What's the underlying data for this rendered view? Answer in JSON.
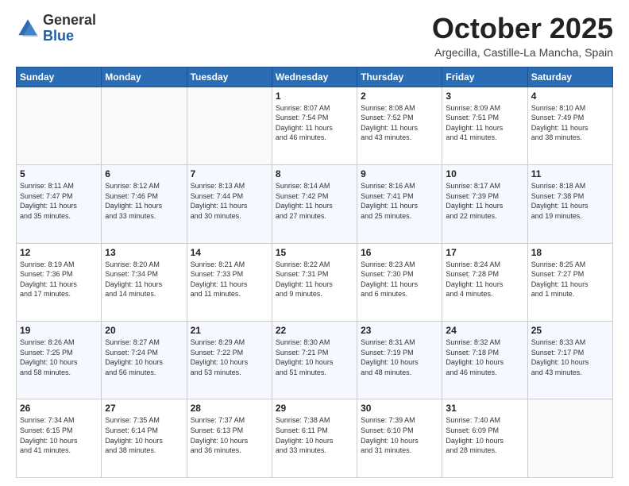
{
  "logo": {
    "general": "General",
    "blue": "Blue"
  },
  "header": {
    "month": "October 2025",
    "location": "Argecilla, Castille-La Mancha, Spain"
  },
  "days_of_week": [
    "Sunday",
    "Monday",
    "Tuesday",
    "Wednesday",
    "Thursday",
    "Friday",
    "Saturday"
  ],
  "weeks": [
    [
      {
        "day": "",
        "info": ""
      },
      {
        "day": "",
        "info": ""
      },
      {
        "day": "",
        "info": ""
      },
      {
        "day": "1",
        "info": "Sunrise: 8:07 AM\nSunset: 7:54 PM\nDaylight: 11 hours\nand 46 minutes."
      },
      {
        "day": "2",
        "info": "Sunrise: 8:08 AM\nSunset: 7:52 PM\nDaylight: 11 hours\nand 43 minutes."
      },
      {
        "day": "3",
        "info": "Sunrise: 8:09 AM\nSunset: 7:51 PM\nDaylight: 11 hours\nand 41 minutes."
      },
      {
        "day": "4",
        "info": "Sunrise: 8:10 AM\nSunset: 7:49 PM\nDaylight: 11 hours\nand 38 minutes."
      }
    ],
    [
      {
        "day": "5",
        "info": "Sunrise: 8:11 AM\nSunset: 7:47 PM\nDaylight: 11 hours\nand 35 minutes."
      },
      {
        "day": "6",
        "info": "Sunrise: 8:12 AM\nSunset: 7:46 PM\nDaylight: 11 hours\nand 33 minutes."
      },
      {
        "day": "7",
        "info": "Sunrise: 8:13 AM\nSunset: 7:44 PM\nDaylight: 11 hours\nand 30 minutes."
      },
      {
        "day": "8",
        "info": "Sunrise: 8:14 AM\nSunset: 7:42 PM\nDaylight: 11 hours\nand 27 minutes."
      },
      {
        "day": "9",
        "info": "Sunrise: 8:16 AM\nSunset: 7:41 PM\nDaylight: 11 hours\nand 25 minutes."
      },
      {
        "day": "10",
        "info": "Sunrise: 8:17 AM\nSunset: 7:39 PM\nDaylight: 11 hours\nand 22 minutes."
      },
      {
        "day": "11",
        "info": "Sunrise: 8:18 AM\nSunset: 7:38 PM\nDaylight: 11 hours\nand 19 minutes."
      }
    ],
    [
      {
        "day": "12",
        "info": "Sunrise: 8:19 AM\nSunset: 7:36 PM\nDaylight: 11 hours\nand 17 minutes."
      },
      {
        "day": "13",
        "info": "Sunrise: 8:20 AM\nSunset: 7:34 PM\nDaylight: 11 hours\nand 14 minutes."
      },
      {
        "day": "14",
        "info": "Sunrise: 8:21 AM\nSunset: 7:33 PM\nDaylight: 11 hours\nand 11 minutes."
      },
      {
        "day": "15",
        "info": "Sunrise: 8:22 AM\nSunset: 7:31 PM\nDaylight: 11 hours\nand 9 minutes."
      },
      {
        "day": "16",
        "info": "Sunrise: 8:23 AM\nSunset: 7:30 PM\nDaylight: 11 hours\nand 6 minutes."
      },
      {
        "day": "17",
        "info": "Sunrise: 8:24 AM\nSunset: 7:28 PM\nDaylight: 11 hours\nand 4 minutes."
      },
      {
        "day": "18",
        "info": "Sunrise: 8:25 AM\nSunset: 7:27 PM\nDaylight: 11 hours\nand 1 minute."
      }
    ],
    [
      {
        "day": "19",
        "info": "Sunrise: 8:26 AM\nSunset: 7:25 PM\nDaylight: 10 hours\nand 58 minutes."
      },
      {
        "day": "20",
        "info": "Sunrise: 8:27 AM\nSunset: 7:24 PM\nDaylight: 10 hours\nand 56 minutes."
      },
      {
        "day": "21",
        "info": "Sunrise: 8:29 AM\nSunset: 7:22 PM\nDaylight: 10 hours\nand 53 minutes."
      },
      {
        "day": "22",
        "info": "Sunrise: 8:30 AM\nSunset: 7:21 PM\nDaylight: 10 hours\nand 51 minutes."
      },
      {
        "day": "23",
        "info": "Sunrise: 8:31 AM\nSunset: 7:19 PM\nDaylight: 10 hours\nand 48 minutes."
      },
      {
        "day": "24",
        "info": "Sunrise: 8:32 AM\nSunset: 7:18 PM\nDaylight: 10 hours\nand 46 minutes."
      },
      {
        "day": "25",
        "info": "Sunrise: 8:33 AM\nSunset: 7:17 PM\nDaylight: 10 hours\nand 43 minutes."
      }
    ],
    [
      {
        "day": "26",
        "info": "Sunrise: 7:34 AM\nSunset: 6:15 PM\nDaylight: 10 hours\nand 41 minutes."
      },
      {
        "day": "27",
        "info": "Sunrise: 7:35 AM\nSunset: 6:14 PM\nDaylight: 10 hours\nand 38 minutes."
      },
      {
        "day": "28",
        "info": "Sunrise: 7:37 AM\nSunset: 6:13 PM\nDaylight: 10 hours\nand 36 minutes."
      },
      {
        "day": "29",
        "info": "Sunrise: 7:38 AM\nSunset: 6:11 PM\nDaylight: 10 hours\nand 33 minutes."
      },
      {
        "day": "30",
        "info": "Sunrise: 7:39 AM\nSunset: 6:10 PM\nDaylight: 10 hours\nand 31 minutes."
      },
      {
        "day": "31",
        "info": "Sunrise: 7:40 AM\nSunset: 6:09 PM\nDaylight: 10 hours\nand 28 minutes."
      },
      {
        "day": "",
        "info": ""
      }
    ]
  ]
}
